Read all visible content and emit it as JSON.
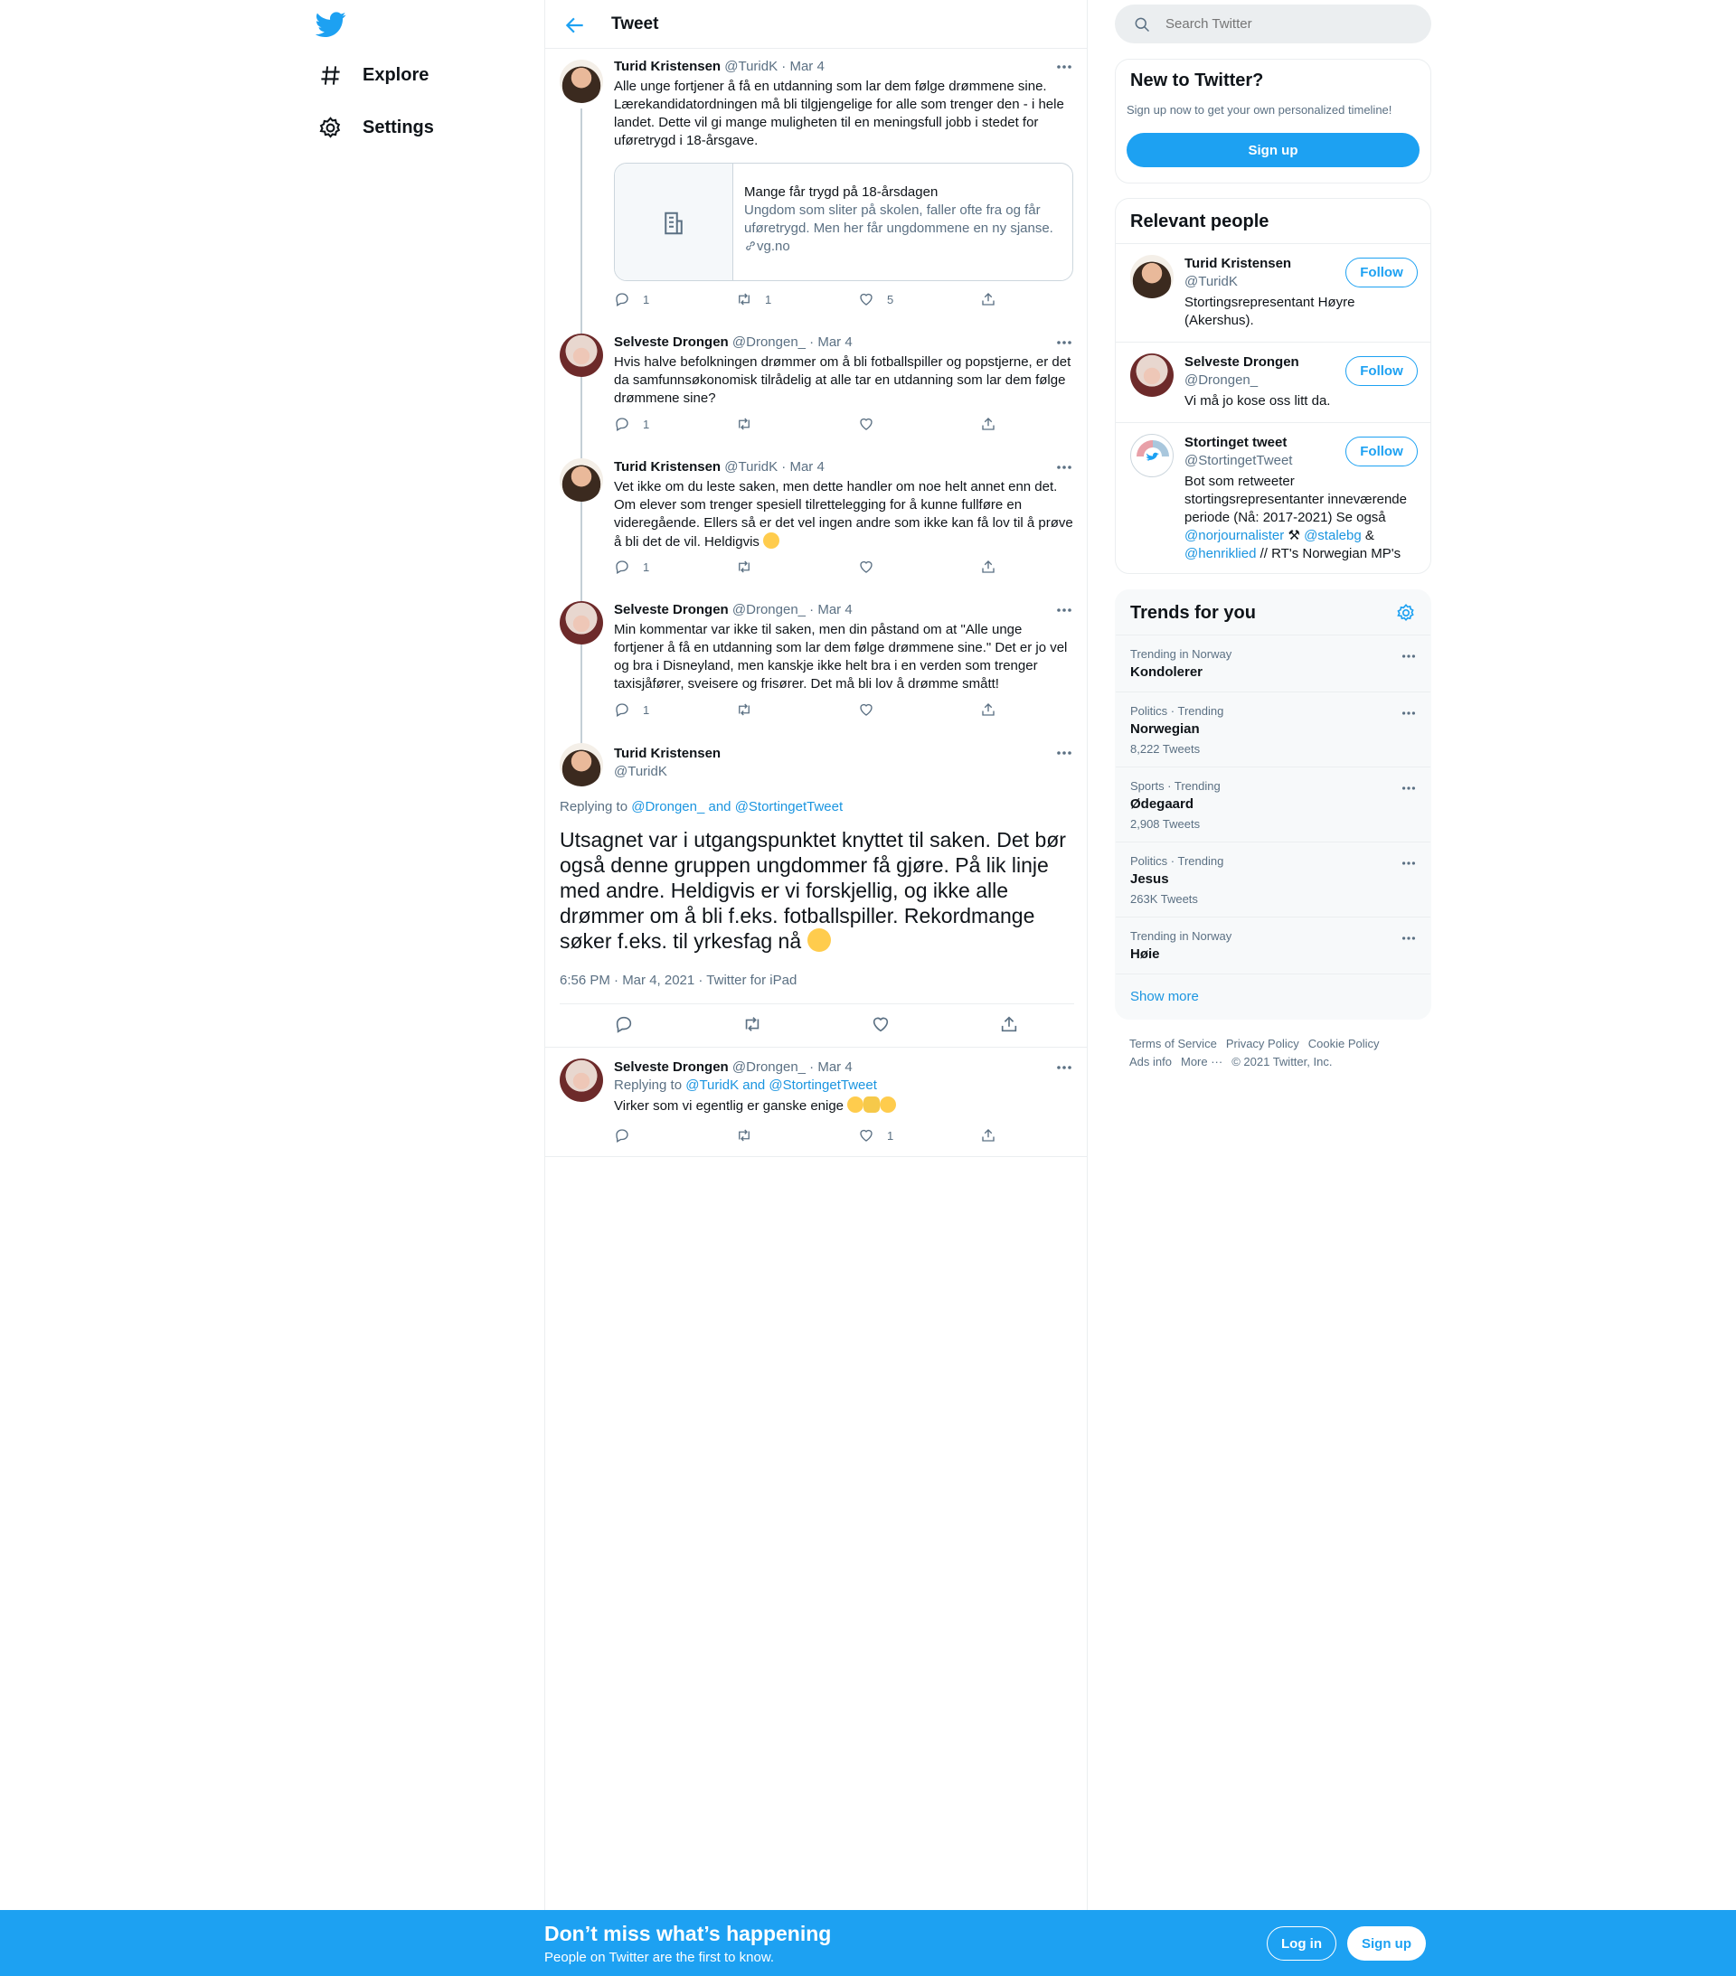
{
  "nav": {
    "explore": "Explore",
    "settings": "Settings"
  },
  "header": {
    "title": "Tweet"
  },
  "tweets": [
    {
      "name": "Turid Kristensen",
      "handle": "@TuridK",
      "date": "· Mar 4",
      "text": "Alle unge fortjener å få en utdanning som lar dem følge drømmene sine. Lærekandidatordningen må bli tilgjengelige for alle som trenger den - i hele landet. Dette vil gi mange muligheten til en meningsfull jobb i stedet for uføretrygd i 18-årsgave.",
      "card": {
        "title": "Mange får trygd på 18-årsdagen",
        "desc": "Ungdom som sliter på skolen, faller ofte fra og får uføretrygd. Men her får ungdommene en ny sjanse.",
        "domain": "vg.no"
      },
      "replies": "1",
      "retweets": "1",
      "likes": "5"
    },
    {
      "name": "Selveste Drongen",
      "handle": "@Drongen_",
      "date": "· Mar 4",
      "text": "Hvis halve befolkningen drømmer om å bli fotballspiller og popstjerne, er det da samfunnsøkonomisk tilrådelig at alle tar en utdanning som lar dem følge drømmene sine?",
      "replies": "1"
    },
    {
      "name": "Turid Kristensen",
      "handle": "@TuridK",
      "date": "· Mar 4",
      "text": "Vet ikke om du leste saken, men dette handler om noe helt annet enn det. Om elever som trenger spesiell tilrettelegging for å kunne fullføre en videregående. Ellers så er det vel ingen andre som ikke kan få lov til å prøve å bli det de vil. Heldigvis",
      "replies": "1"
    },
    {
      "name": "Selveste Drongen",
      "handle": "@Drongen_",
      "date": "· Mar 4",
      "text": "Min kommentar var ikke til saken, men din påstand om at \"Alle unge fortjener å få en utdanning som lar dem følge drømmene sine.\" Det er jo vel og bra i Disneyland, men kanskje ikke helt bra i en verden som trenger taxisjåfører, sveisere og frisører. Det må bli lov å drømme smått!",
      "replies": "1"
    }
  ],
  "focused": {
    "name": "Turid Kristensen",
    "handle": "@TuridK",
    "replying_prefix": "Replying to",
    "replying_to": "@Drongen_ and @StortingetTweet",
    "text": "Utsagnet var i utgangspunktet knyttet til saken. Det bør også denne gruppen ungdommer få gjøre. På lik linje med andre. Heldigvis er vi forskjellig, og ikke alle drømmer om å bli f.eks. fotballspiller. Rekordmange søker f.eks. til yrkesfag nå",
    "timestamp": "6:56 PM · Mar 4, 2021 · Twitter for iPad"
  },
  "reply": {
    "name": "Selveste Drongen",
    "handle": "@Drongen_",
    "date": "· Mar 4",
    "replying_prefix": "Replying to",
    "replying_to": "@TuridK and @StortingetTweet",
    "text": "Virker som vi egentlig er ganske enige",
    "likes": "1"
  },
  "search": {
    "placeholder": "Search Twitter"
  },
  "new_to_twitter": {
    "title": "New to Twitter?",
    "subtitle": "Sign up now to get your own personalized timeline!",
    "button": "Sign up"
  },
  "relevant": {
    "title": "Relevant people",
    "follow_label": "Follow",
    "people": [
      {
        "name": "Turid Kristensen",
        "handle": "@TuridK",
        "bio": "Stortingsrepresentant Høyre (Akershus)."
      },
      {
        "name": "Selveste Drongen",
        "handle": "@Drongen_",
        "bio": "Vi må jo kose oss litt da."
      },
      {
        "name": "Stortinget tweet",
        "handle": "@StortingetTweet",
        "bio_a": "Bot som retweeter stortingsrepresentanter inneværende periode (Nå: 2017-2021) Se også",
        "link1": "@norjournalister",
        "link2": "@stalebg",
        "amp": "&",
        "link3": "@henriklied",
        "bio_b": "// RT's Norwegian MP's"
      }
    ]
  },
  "trends": {
    "title": "Trends for you",
    "items": [
      {
        "context": "Trending in Norway",
        "name": "Kondolerer",
        "count": ""
      },
      {
        "context": "Politics · Trending",
        "name": "Norwegian",
        "count": "8,222 Tweets"
      },
      {
        "context": "Sports · Trending",
        "name": "Ødegaard",
        "count": "2,908 Tweets"
      },
      {
        "context": "Politics · Trending",
        "name": "Jesus",
        "count": "263K Tweets"
      },
      {
        "context": "Trending in Norway",
        "name": "Høie",
        "count": ""
      }
    ],
    "show_more": "Show more"
  },
  "footer": {
    "terms": "Terms of Service",
    "privacy": "Privacy Policy",
    "cookie": "Cookie Policy",
    "ads": "Ads info",
    "more": "More ···",
    "copyright": "© 2021 Twitter, Inc."
  },
  "banner": {
    "title": "Don’t miss what’s happening",
    "subtitle": "People on Twitter are the first to know.",
    "login": "Log in",
    "signup": "Sign up"
  },
  "colors": {
    "accent": "#1da1f2",
    "link": "#1b95e0",
    "secondary_text": "#5b7083",
    "border": "#ebeef0"
  }
}
